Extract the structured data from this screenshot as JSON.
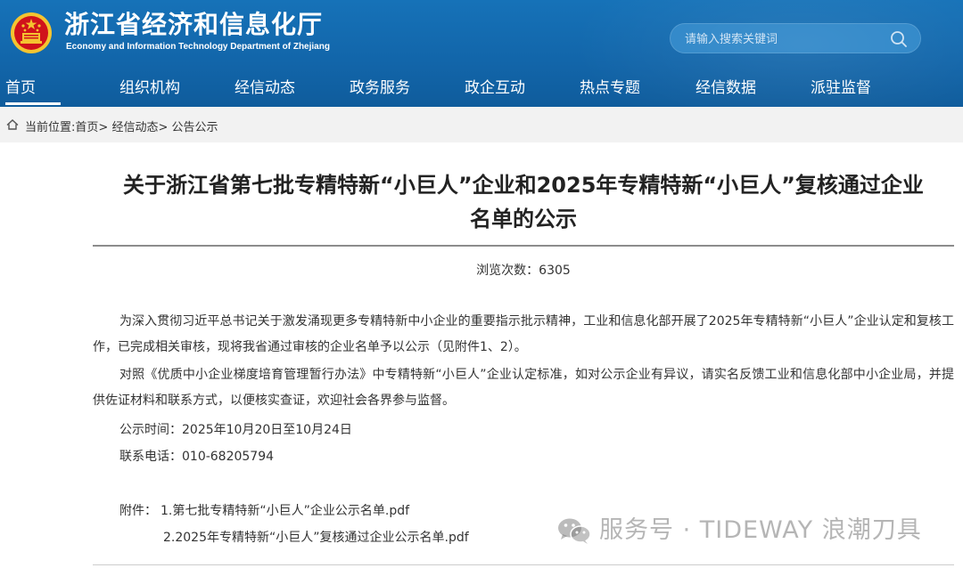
{
  "header": {
    "title": "浙江省经济和信息化厅",
    "subtitle": "Economy and Information Technology Department of Zhejiang",
    "search_placeholder": "请输入搜索关键词"
  },
  "nav": {
    "items": [
      "首页",
      "组织机构",
      "经信动态",
      "政务服务",
      "政企互动",
      "热点专题",
      "经信数据",
      "派驻监督"
    ],
    "active_index": 0
  },
  "breadcrumb": {
    "prefix": "当前位置:",
    "items": [
      "首页",
      "经信动态",
      "公告公示"
    ],
    "separator": ">"
  },
  "article": {
    "title_line1": "关于浙江省第七批专精特新“小巨人”企业和2025年专精特新“小巨人”复核通过企业",
    "title_line2": "名单的公示",
    "views": "浏览次数：6305",
    "paragraph1": "为深入贯彻习近平总书记关于激发涌现更多专精特新中小企业的重要指示批示精神，工业和信息化部开展了2025年专精特新“小巨人”企业认定和复核工作，已完成相关审核，现将我省通过审核的企业名单予以公示（见附件1、2）。",
    "paragraph2": "对照《优质中小企业梯度培育管理暂行办法》中专精特新“小巨人”企业认定标准，如对公示企业有异议，请实名反馈工业和信息化部中小企业局，并提供佐证材料和联系方式，以便核实查证，欢迎社会各界参与监督。",
    "publish_time": "公示时间：2025年10月20日至10月24日",
    "contact": "联系电话：010-68205794",
    "attachments_label": "附件：",
    "attachments": [
      "1.第七批专精特新“小巨人”企业公示名单.pdf",
      "2.2025年专精特新“小巨人”复核通过企业公示名单.pdf"
    ]
  },
  "watermark": {
    "text": "服务号 · TIDEWAY 浪潮刀具",
    "icon": "wechat-icon"
  },
  "colors": {
    "header_blue": "#1265a9",
    "search_bg": "#2d86c8",
    "breadcrumb_bg": "#f2f2f2",
    "emblem_red": "#d0121b",
    "emblem_gold": "#f4c430"
  }
}
